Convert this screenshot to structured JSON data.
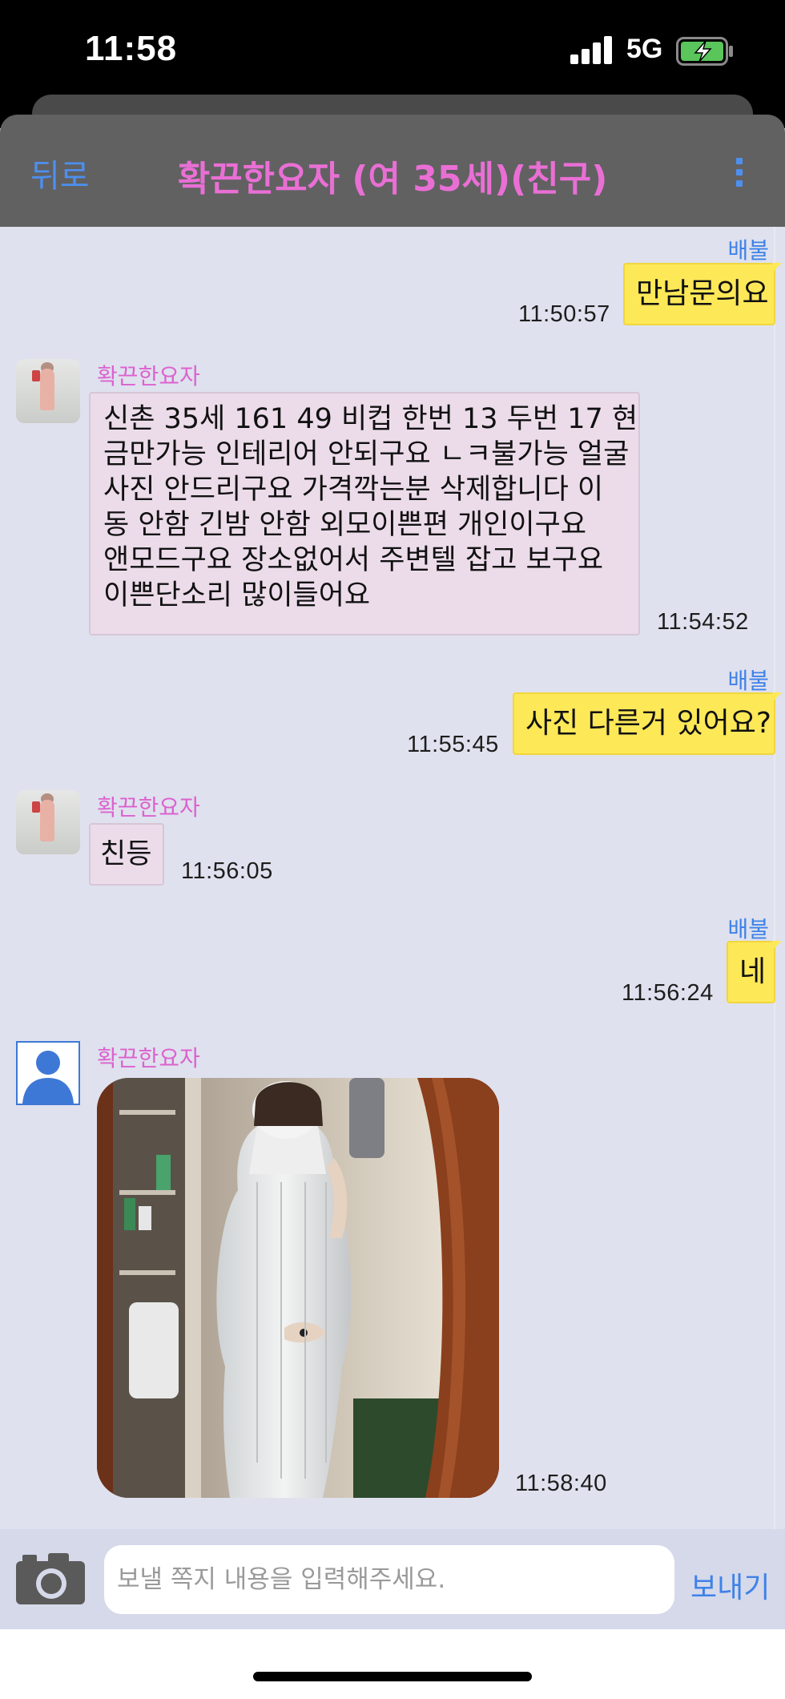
{
  "status_bar": {
    "time": "11:58",
    "network": "5G",
    "battery_state": "charging"
  },
  "header": {
    "back_label": "뒤로",
    "title": "확끈한요자 (여 35세)(친구)",
    "menu_icon": "vertical-dots-icon"
  },
  "colors": {
    "accent_blue": "#4d8ff0",
    "friend_pink": "#e96fd5",
    "my_bubble": "#fde858",
    "their_bubble": "#ecdcea",
    "chat_bg": "#dfe1ee"
  },
  "messages": [
    {
      "id": "m1",
      "from": "me",
      "sender": "배불",
      "text": "만남문의요",
      "time": "11:50:57"
    },
    {
      "id": "m2",
      "from": "friend",
      "sender": "확끈한요자",
      "lines": [
        "신촌 35세  161 49 비컵 한번 13 두번 17 현",
        "금만가능 인테리어 안되구요 ㄴㅋ불가능 얼굴",
        "사진 안드리구요 가격깍는분 삭제합니다  이",
        "동 안함 긴밤  안함 외모이쁜편 개인이구요",
        "앤모드구요 장소없어서 주변텔 잡고 보구요",
        "이쁜단소리  많이들어요"
      ],
      "time": "11:54:52"
    },
    {
      "id": "m3",
      "from": "me",
      "sender": "배불",
      "text": "사진 다른거 있어요?",
      "time": "11:55:45"
    },
    {
      "id": "m4",
      "from": "friend",
      "sender": "확끈한요자",
      "text": "친등",
      "time": "11:56:05"
    },
    {
      "id": "m5",
      "from": "me",
      "sender": "배불",
      "text": "네",
      "time": "11:56:24"
    },
    {
      "id": "m6",
      "from": "friend",
      "sender": "확끈한요자",
      "type": "photo",
      "time": "11:58:40"
    }
  ],
  "composer": {
    "camera_icon": "camera-icon",
    "placeholder": "보낼 쪽지 내용을 입력해주세요.",
    "value": "",
    "send_label": "보내기"
  }
}
